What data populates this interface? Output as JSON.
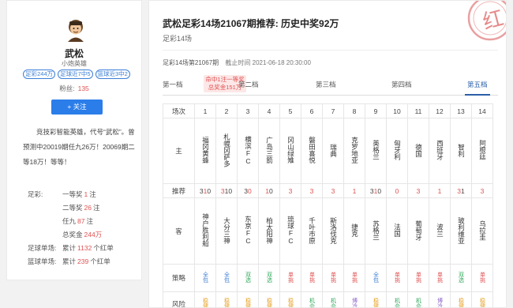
{
  "profile": {
    "name": "武松",
    "subtitle": "小炮英雄",
    "tags": [
      "足彩244万",
      "足球近7中5",
      "篮球近3中2"
    ],
    "fans_label": "粉丝:",
    "fans_value": "135",
    "follow_label": "+ 关注",
    "bio": "竞技彩智能英雄，代号“武松”。曾预测中20019期任九26万！20069期二等18万！等等！",
    "stats": [
      {
        "k": "足彩:",
        "k2": "一等奖",
        "v": "1",
        "u": "注"
      },
      {
        "k": "",
        "k2": "二等奖",
        "v": "26",
        "u": "注"
      },
      {
        "k": "",
        "k2": "任九",
        "v": "87",
        "u": "注"
      },
      {
        "k": "",
        "k2": "总奖金",
        "v": "244万",
        "u": ""
      },
      {
        "k": "足球单场:",
        "k2": "累计",
        "v": "1132",
        "u": "个红单"
      },
      {
        "k": "篮球单场:",
        "k2": "累计",
        "v": "239",
        "u": "个红单"
      }
    ]
  },
  "article": {
    "title": "武松足彩14场21067期推荐: 历史中奖92万",
    "subtitle": "足彩14场",
    "issue": "足彩14场第21067期",
    "time_label": "截止时间",
    "time_value": "2021-06-18 20:30:00",
    "stamp_char": "红"
  },
  "tabs": {
    "items": [
      "第一档",
      "第二档",
      "第三档",
      "第四档",
      "第五档"
    ],
    "active": "第五档",
    "hit_line1": "命中1注一等奖",
    "hit_line2": "总奖金151万"
  },
  "table": {
    "row_labels": {
      "head": "场次",
      "home": "主",
      "rec": "推荐",
      "away": "客",
      "strategy": "策略",
      "risk": "风险"
    },
    "matches": [
      {
        "no": "1",
        "home": "福冈黄蜂",
        "rec": [
          [
            "3",
            "n"
          ],
          [
            "1",
            "h"
          ],
          [
            "0",
            "n"
          ]
        ],
        "away": "神户胜利船",
        "strategy": "全包",
        "sc": "blue",
        "risk": "稳健",
        "rc": "orange"
      },
      {
        "no": "2",
        "home": "札幌冈萨多",
        "rec": [
          [
            "3",
            "h"
          ],
          [
            "1",
            "n"
          ],
          [
            "0",
            "n"
          ]
        ],
        "away": "大分三神",
        "strategy": "全包",
        "sc": "blue",
        "risk": "稳健",
        "rc": "orange"
      },
      {
        "no": "3",
        "home": "横滨FC",
        "rec": [
          [
            "3",
            "n"
          ],
          [
            "0",
            "h"
          ]
        ],
        "away": "东京FC",
        "strategy": "双选",
        "sc": "green",
        "risk": "稳健",
        "rc": "orange"
      },
      {
        "no": "4",
        "home": "广岛三箭",
        "rec": [
          [
            "1",
            "h"
          ],
          [
            "0",
            "n"
          ]
        ],
        "away": "柏太阳神",
        "strategy": "双选",
        "sc": "green",
        "risk": "稳健",
        "rc": "orange"
      },
      {
        "no": "5",
        "home": "冈山绿雉",
        "rec": [
          [
            "3",
            "h"
          ]
        ],
        "away": "琉球FC",
        "strategy": "单挑",
        "sc": "red",
        "risk": "稳健",
        "rc": "orange"
      },
      {
        "no": "6",
        "home": "磐田喜悦",
        "rec": [
          [
            "3",
            "h"
          ]
        ],
        "away": "千叶市原",
        "strategy": "单挑",
        "sc": "red",
        "risk": "机会",
        "rc": "green"
      },
      {
        "no": "7",
        "home": "瑞典",
        "rec": [
          [
            "3",
            "h"
          ]
        ],
        "away": "斯洛伐克",
        "strategy": "单挑",
        "sc": "red",
        "risk": "机会",
        "rc": "green"
      },
      {
        "no": "8",
        "home": "克罗地亚",
        "rec": [
          [
            "1",
            "h"
          ]
        ],
        "away": "捷克",
        "strategy": "单挑",
        "sc": "red",
        "risk": "博冷",
        "rc": "purple"
      },
      {
        "no": "9",
        "home": "英格兰",
        "rec": [
          [
            "3",
            "n"
          ],
          [
            "1",
            "h"
          ],
          [
            "0",
            "n"
          ]
        ],
        "away": "苏格兰",
        "strategy": "全包",
        "sc": "blue",
        "risk": "稳健",
        "rc": "orange"
      },
      {
        "no": "10",
        "home": "匈牙利",
        "rec": [
          [
            "0",
            "h"
          ]
        ],
        "away": "法国",
        "strategy": "单挑",
        "sc": "red",
        "risk": "机会",
        "rc": "green"
      },
      {
        "no": "11",
        "home": "德国",
        "rec": [
          [
            "3",
            "h"
          ]
        ],
        "away": "葡萄牙",
        "strategy": "单挑",
        "sc": "red",
        "risk": "机会",
        "rc": "green"
      },
      {
        "no": "12",
        "home": "西班牙",
        "rec": [
          [
            "1",
            "h"
          ]
        ],
        "away": "波兰",
        "strategy": "单挑",
        "sc": "red",
        "risk": "博冷",
        "rc": "purple"
      },
      {
        "no": "13",
        "home": "智利",
        "rec": [
          [
            "3",
            "h"
          ],
          [
            "1",
            "n"
          ]
        ],
        "away": "玻利维亚",
        "strategy": "双选",
        "sc": "green",
        "risk": "稳健",
        "rc": "orange"
      },
      {
        "no": "14",
        "home": "阿根廷",
        "rec": [
          [
            "3",
            "h"
          ]
        ],
        "away": "乌拉圭",
        "strategy": "单挑",
        "sc": "red",
        "risk": "稳健",
        "rc": "orange"
      }
    ]
  },
  "colors": {
    "accent": "#2b7de9",
    "red": "#e05252",
    "blue": "#3d7fd6",
    "green": "#2fa85a",
    "purple": "#8a63c8",
    "orange": "#e6a020"
  }
}
